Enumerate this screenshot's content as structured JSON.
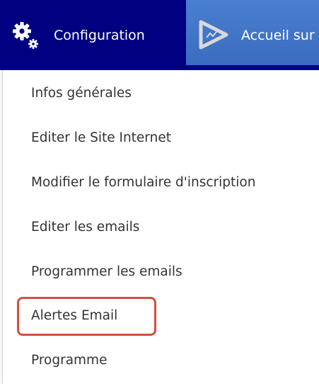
{
  "nav": {
    "configuration": {
      "label": "Configuration",
      "icon": "gears-icon"
    },
    "accueil": {
      "label": "Accueil sur",
      "icon": "play-icon"
    }
  },
  "menu": {
    "items": [
      {
        "label": "Infos générales"
      },
      {
        "label": "Editer le Site Internet"
      },
      {
        "label": "Modifier le formulaire d'inscription"
      },
      {
        "label": "Editer les emails"
      },
      {
        "label": "Programmer les emails"
      },
      {
        "label": "Alertes Email",
        "highlighted": true
      },
      {
        "label": "Programme"
      }
    ]
  },
  "colors": {
    "nav_background": "#000080",
    "accueil_background": "#3c6fc4",
    "menu_text": "#333333",
    "highlight_border": "#d24e3e"
  }
}
